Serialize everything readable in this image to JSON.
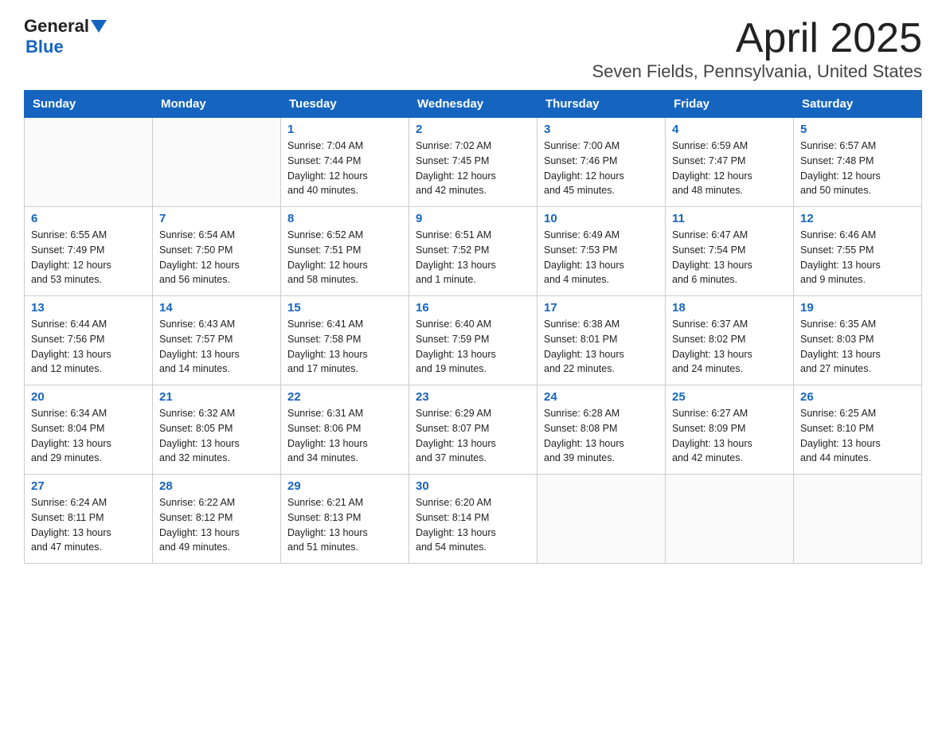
{
  "header": {
    "logo_general": "General",
    "logo_blue": "Blue",
    "title": "April 2025",
    "subtitle": "Seven Fields, Pennsylvania, United States"
  },
  "days_of_week": [
    "Sunday",
    "Monday",
    "Tuesday",
    "Wednesday",
    "Thursday",
    "Friday",
    "Saturday"
  ],
  "weeks": [
    [
      {
        "num": "",
        "info": ""
      },
      {
        "num": "",
        "info": ""
      },
      {
        "num": "1",
        "info": "Sunrise: 7:04 AM\nSunset: 7:44 PM\nDaylight: 12 hours\nand 40 minutes."
      },
      {
        "num": "2",
        "info": "Sunrise: 7:02 AM\nSunset: 7:45 PM\nDaylight: 12 hours\nand 42 minutes."
      },
      {
        "num": "3",
        "info": "Sunrise: 7:00 AM\nSunset: 7:46 PM\nDaylight: 12 hours\nand 45 minutes."
      },
      {
        "num": "4",
        "info": "Sunrise: 6:59 AM\nSunset: 7:47 PM\nDaylight: 12 hours\nand 48 minutes."
      },
      {
        "num": "5",
        "info": "Sunrise: 6:57 AM\nSunset: 7:48 PM\nDaylight: 12 hours\nand 50 minutes."
      }
    ],
    [
      {
        "num": "6",
        "info": "Sunrise: 6:55 AM\nSunset: 7:49 PM\nDaylight: 12 hours\nand 53 minutes."
      },
      {
        "num": "7",
        "info": "Sunrise: 6:54 AM\nSunset: 7:50 PM\nDaylight: 12 hours\nand 56 minutes."
      },
      {
        "num": "8",
        "info": "Sunrise: 6:52 AM\nSunset: 7:51 PM\nDaylight: 12 hours\nand 58 minutes."
      },
      {
        "num": "9",
        "info": "Sunrise: 6:51 AM\nSunset: 7:52 PM\nDaylight: 13 hours\nand 1 minute."
      },
      {
        "num": "10",
        "info": "Sunrise: 6:49 AM\nSunset: 7:53 PM\nDaylight: 13 hours\nand 4 minutes."
      },
      {
        "num": "11",
        "info": "Sunrise: 6:47 AM\nSunset: 7:54 PM\nDaylight: 13 hours\nand 6 minutes."
      },
      {
        "num": "12",
        "info": "Sunrise: 6:46 AM\nSunset: 7:55 PM\nDaylight: 13 hours\nand 9 minutes."
      }
    ],
    [
      {
        "num": "13",
        "info": "Sunrise: 6:44 AM\nSunset: 7:56 PM\nDaylight: 13 hours\nand 12 minutes."
      },
      {
        "num": "14",
        "info": "Sunrise: 6:43 AM\nSunset: 7:57 PM\nDaylight: 13 hours\nand 14 minutes."
      },
      {
        "num": "15",
        "info": "Sunrise: 6:41 AM\nSunset: 7:58 PM\nDaylight: 13 hours\nand 17 minutes."
      },
      {
        "num": "16",
        "info": "Sunrise: 6:40 AM\nSunset: 7:59 PM\nDaylight: 13 hours\nand 19 minutes."
      },
      {
        "num": "17",
        "info": "Sunrise: 6:38 AM\nSunset: 8:01 PM\nDaylight: 13 hours\nand 22 minutes."
      },
      {
        "num": "18",
        "info": "Sunrise: 6:37 AM\nSunset: 8:02 PM\nDaylight: 13 hours\nand 24 minutes."
      },
      {
        "num": "19",
        "info": "Sunrise: 6:35 AM\nSunset: 8:03 PM\nDaylight: 13 hours\nand 27 minutes."
      }
    ],
    [
      {
        "num": "20",
        "info": "Sunrise: 6:34 AM\nSunset: 8:04 PM\nDaylight: 13 hours\nand 29 minutes."
      },
      {
        "num": "21",
        "info": "Sunrise: 6:32 AM\nSunset: 8:05 PM\nDaylight: 13 hours\nand 32 minutes."
      },
      {
        "num": "22",
        "info": "Sunrise: 6:31 AM\nSunset: 8:06 PM\nDaylight: 13 hours\nand 34 minutes."
      },
      {
        "num": "23",
        "info": "Sunrise: 6:29 AM\nSunset: 8:07 PM\nDaylight: 13 hours\nand 37 minutes."
      },
      {
        "num": "24",
        "info": "Sunrise: 6:28 AM\nSunset: 8:08 PM\nDaylight: 13 hours\nand 39 minutes."
      },
      {
        "num": "25",
        "info": "Sunrise: 6:27 AM\nSunset: 8:09 PM\nDaylight: 13 hours\nand 42 minutes."
      },
      {
        "num": "26",
        "info": "Sunrise: 6:25 AM\nSunset: 8:10 PM\nDaylight: 13 hours\nand 44 minutes."
      }
    ],
    [
      {
        "num": "27",
        "info": "Sunrise: 6:24 AM\nSunset: 8:11 PM\nDaylight: 13 hours\nand 47 minutes."
      },
      {
        "num": "28",
        "info": "Sunrise: 6:22 AM\nSunset: 8:12 PM\nDaylight: 13 hours\nand 49 minutes."
      },
      {
        "num": "29",
        "info": "Sunrise: 6:21 AM\nSunset: 8:13 PM\nDaylight: 13 hours\nand 51 minutes."
      },
      {
        "num": "30",
        "info": "Sunrise: 6:20 AM\nSunset: 8:14 PM\nDaylight: 13 hours\nand 54 minutes."
      },
      {
        "num": "",
        "info": ""
      },
      {
        "num": "",
        "info": ""
      },
      {
        "num": "",
        "info": ""
      }
    ]
  ]
}
